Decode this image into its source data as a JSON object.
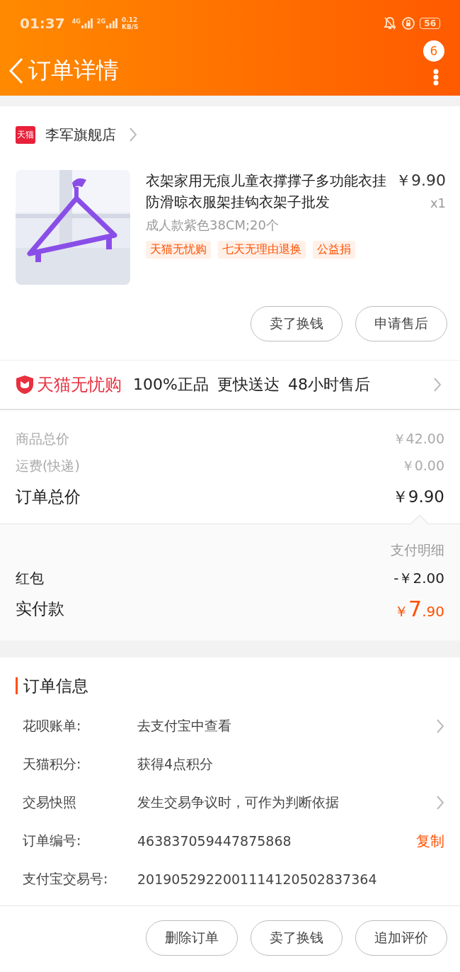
{
  "status_bar": {
    "time": "01:37",
    "signals": [
      "4G",
      "2G"
    ],
    "speed": "0.12",
    "speed_unit": "KB/S",
    "battery": "56"
  },
  "header": {
    "title": "订单详情",
    "badge": "6"
  },
  "store": {
    "logo": "天猫",
    "name": "李军旗舰店"
  },
  "product": {
    "title": "衣架家用无痕儿童衣撑撑子多功能衣挂防滑晾衣服架挂钩衣架子批发",
    "price": "￥9.90",
    "quantity": "x1",
    "sku": "成人款紫色38CM;20个",
    "tags": [
      "天猫无忧购",
      "七天无理由退换",
      "公益捐"
    ],
    "buttons": [
      "卖了换钱",
      "申请售后"
    ]
  },
  "guarantee": {
    "brand": "天猫无忧购",
    "items": [
      "100%正品",
      "更快送达",
      "48小时售后"
    ]
  },
  "price_rows": [
    {
      "label": "商品总价",
      "value": "￥42.00",
      "kind": "minor"
    },
    {
      "label": "运费(快递)",
      "value": "￥0.00",
      "kind": "minor"
    },
    {
      "label": "订单总价",
      "value": "￥9.90",
      "kind": "major"
    }
  ],
  "payment": {
    "title": "支付明细",
    "rows": [
      {
        "label": "红包",
        "value": "-￥2.00"
      }
    ],
    "paid": {
      "label": "实付款",
      "currency": "￥",
      "integer": "7",
      "decimal": ".90"
    }
  },
  "order_info": {
    "title": "订单信息",
    "rows": [
      {
        "label": "花呗账单:",
        "value": "去支付宝中查看",
        "kind": "link"
      },
      {
        "label": "天猫积分:",
        "value": "获得4点积分",
        "kind": "plain"
      },
      {
        "label": "交易快照",
        "value": "发生交易争议时，可作为判断依据",
        "kind": "link"
      },
      {
        "label": "订单编号:",
        "value": "463837059447875868",
        "kind": "copy",
        "action": "复制"
      },
      {
        "label": "支付宝交易号:",
        "value": "2019052922001114120502837364",
        "kind": "plain"
      }
    ]
  },
  "bottom_buttons": [
    "删除订单",
    "卖了换钱",
    "追加评价"
  ]
}
